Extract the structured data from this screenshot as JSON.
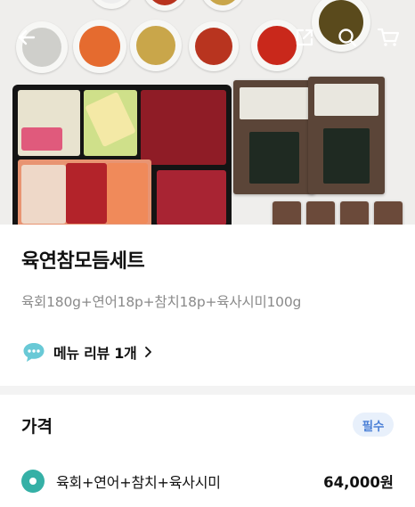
{
  "header": {
    "back_icon": "back-arrow-icon",
    "share_icon": "share-icon",
    "search_icon": "search-icon",
    "cart_icon": "cart-icon"
  },
  "product": {
    "name": "육연참모듬세트",
    "description": "육회180g+연어18p+참치18p+육사시미100g",
    "review_label": "메뉴 리뷰 1개"
  },
  "price_section": {
    "heading": "가격",
    "badge": "필수",
    "options": [
      {
        "label": "육회+연어+참치+육사시미",
        "price": "64,000원",
        "selected": true
      }
    ]
  },
  "colors": {
    "radio_selected": "#35b0a6",
    "badge_text": "#4a7fd6",
    "badge_bg": "#e8f0fb"
  }
}
